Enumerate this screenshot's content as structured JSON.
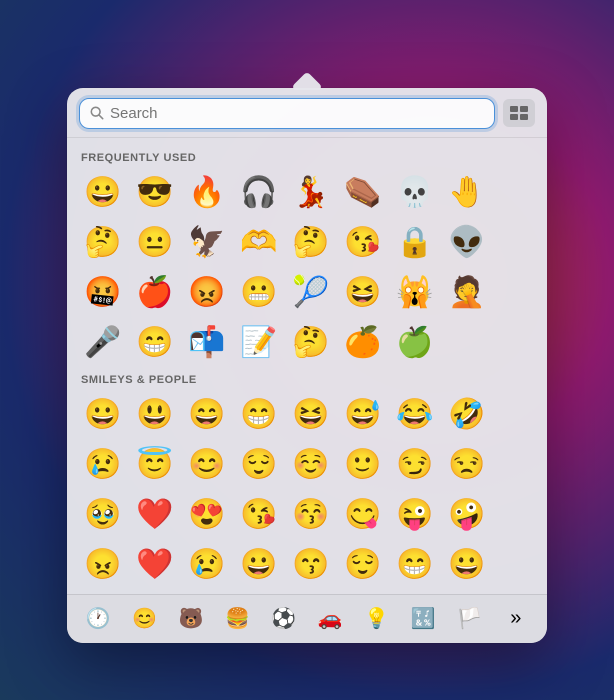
{
  "search": {
    "placeholder": "Search",
    "value": ""
  },
  "sections": [
    {
      "id": "frequently-used",
      "label": "FREQUENTLY USED",
      "emojis": [
        "😀",
        "😎",
        "🔥",
        "🎧",
        "💃",
        "⚰️",
        "💀",
        "🤚",
        "🤔",
        "😐",
        "🦅",
        "🫶",
        "🤔",
        "😘",
        "🔒",
        "👽",
        "@#!%",
        "🍎",
        "😡",
        "😬",
        "🎾",
        "😆",
        "🙀",
        "🤦",
        "🎤",
        "😁",
        "📬",
        "📝",
        "🤔",
        "🍊",
        "🍏"
      ]
    },
    {
      "id": "smileys-people",
      "label": "SMILEYS & PEOPLE",
      "emojis": [
        "😀",
        "😃",
        "😄",
        "😁",
        "😆",
        "😅",
        "😂",
        "🤣",
        "😢",
        "😇",
        "😊",
        "😌",
        "☺️",
        "🙂",
        "😏",
        "😒",
        "🥹",
        "❤️",
        "😍",
        "😘",
        "😚",
        "😋",
        "😜",
        "🤪"
      ]
    }
  ],
  "categories": [
    {
      "id": "recent",
      "icon": "🕐",
      "active": true
    },
    {
      "id": "smileys",
      "icon": "😊",
      "active": false
    },
    {
      "id": "animals",
      "icon": "🐻",
      "active": false
    },
    {
      "id": "food",
      "icon": "🍔",
      "active": false
    },
    {
      "id": "activities",
      "icon": "⚽",
      "active": false
    },
    {
      "id": "travel",
      "icon": "🚗",
      "active": false
    },
    {
      "id": "objects",
      "icon": "💡",
      "active": false
    },
    {
      "id": "symbols",
      "icon": "🔣",
      "active": false
    },
    {
      "id": "flags",
      "icon": "🏳️",
      "active": false
    },
    {
      "id": "more",
      "icon": "»",
      "active": false
    }
  ],
  "frequently_used_emojis": [
    "😀",
    "😎",
    "🔥",
    "🎧",
    "💃",
    "⚰️",
    "💀",
    "🤚",
    "🤔",
    "😐",
    "🦅",
    "🫶",
    "🤔",
    "😘",
    "🔒",
    "👽",
    "🤬",
    "🍎",
    "😡",
    "😬",
    "🎾",
    "😆",
    "🙀",
    "🤦",
    "🎤",
    "😁",
    "📬",
    "📝",
    "🤔",
    "🍊",
    "🍏"
  ],
  "smileys_emojis": [
    "😀",
    "😃",
    "😄",
    "😁",
    "😆",
    "😅",
    "😂",
    "🤣",
    "😢",
    "😇",
    "😊",
    "😌",
    "☺️",
    "🙂",
    "😏",
    "😒",
    "🥹",
    "❤️",
    "😍",
    "😘",
    "😚",
    "😋",
    "😜",
    "🤪"
  ]
}
